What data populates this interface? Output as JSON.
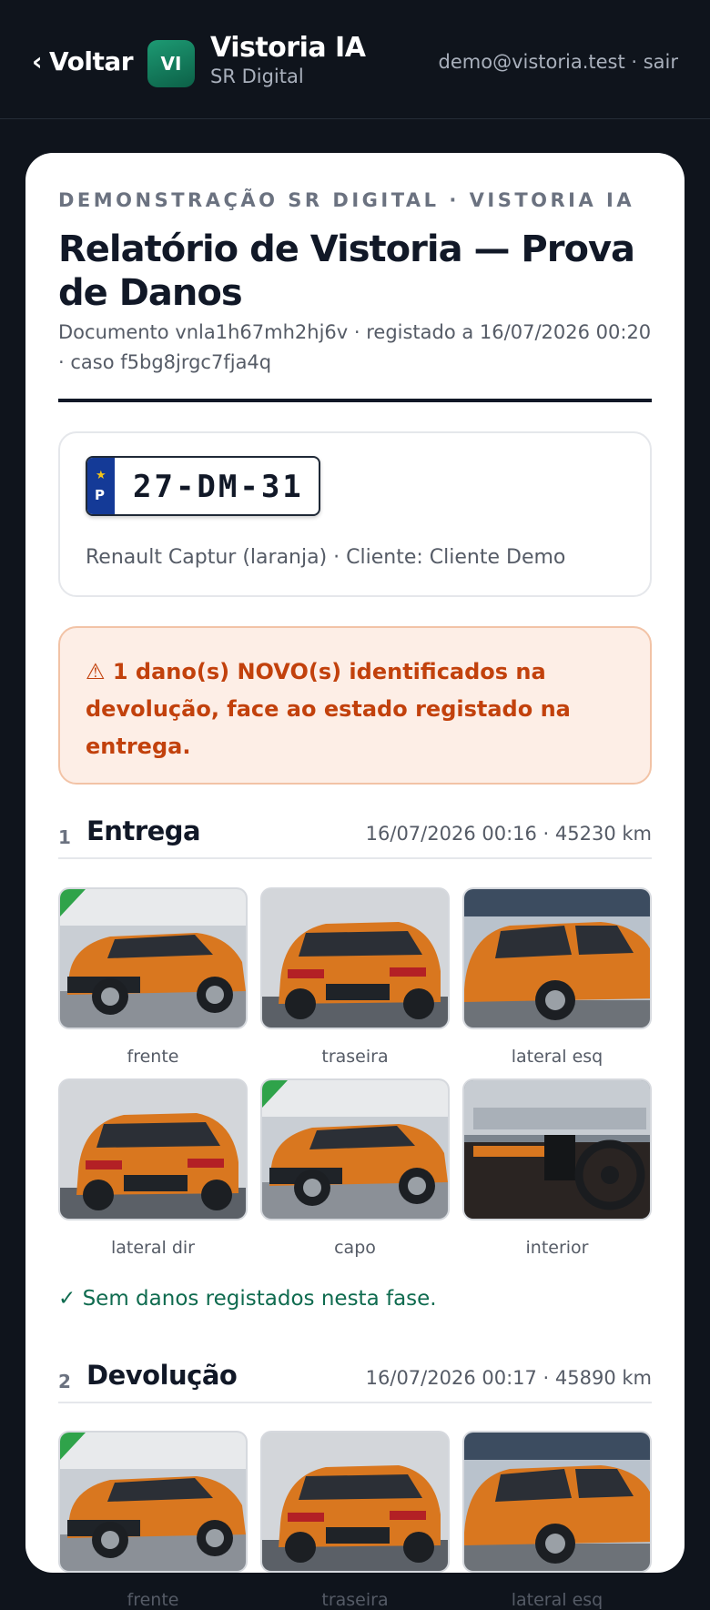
{
  "header": {
    "back_label": "Voltar",
    "logo_initials": "VI",
    "app_title": "Vistoria IA",
    "app_subtitle": "SR Digital",
    "user": "demo@vistoria.test · sair"
  },
  "report": {
    "kicker": "DEMONSTRAÇÃO SR DIGITAL · VISTORIA IA",
    "title": "Relatório de Vistoria — Prova de Danos",
    "meta": "Documento vnla1h67mh2hj6v · registado a 16/07/2026 00:20 · caso f5bg8jrgc7fja4q"
  },
  "vehicle": {
    "plate_country": "P",
    "plate_number": "27-DM-31",
    "description": "Renault Captur (laranja) · Cliente: Cliente Demo"
  },
  "alert": {
    "icon": "warning-icon",
    "text": "⚠ 1 dano(s) NOVO(s) identificados na devolução, face ao estado registado na entrega."
  },
  "sections": [
    {
      "number": "1",
      "name": "Entrega",
      "info": "16/07/2026 00:16 · 45230 km",
      "photos": [
        {
          "caption": "frente"
        },
        {
          "caption": "traseira"
        },
        {
          "caption": "lateral esq"
        },
        {
          "caption": "lateral dir"
        },
        {
          "caption": "capo"
        },
        {
          "caption": "interior"
        }
      ],
      "status": "✓ Sem danos registados nesta fase."
    },
    {
      "number": "2",
      "name": "Devolução",
      "info": "16/07/2026 00:17 · 45890 km",
      "photos": [
        {
          "caption": "frente"
        },
        {
          "caption": "traseira"
        },
        {
          "caption": "lateral esq"
        }
      ]
    }
  ],
  "colors": {
    "background": "#0f141c",
    "accent": "#0f6b4f",
    "alert_text": "#c2410c",
    "alert_bg": "#fdeee6",
    "car_orange": "#d9771f"
  }
}
